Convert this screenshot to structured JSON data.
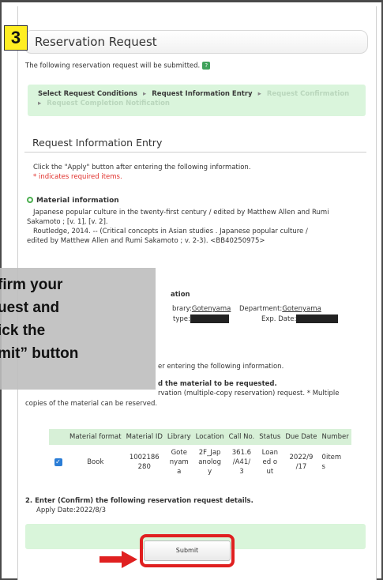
{
  "step_badge": "3",
  "title": "Reservation Request",
  "intro": "The following reservation request will be submitted.",
  "steps": {
    "s1": "Select Request Conditions",
    "s2": "Request Information Entry",
    "s3": "Request Confirmation",
    "s4": "Request Completion Notification",
    "separator": "▸"
  },
  "section_title": "Request Information Entry",
  "instructions": {
    "line1": "Click the \"Apply\" button after entering the following information.",
    "line2": "* indicates required items."
  },
  "material": {
    "heading": "Material information",
    "line1": "Japanese popular culture in the twenty-first century / edited by Matthew Allen and Rumi",
    "line2": "Sakamoto ; [v. 1], [v. 2].",
    "line3": "Routledge, 2014. -- (Critical concepts in Asian studies . Japanese popular culture /",
    "line4": "edited by Matthew Allen and Rumi Sakamoto ; v. 2-3).  <BB40250975>"
  },
  "user_info": {
    "heading_partial": "ation",
    "library_label": "brary:",
    "library_value": "Gotenyama",
    "type_label": "type:",
    "department_label": "Department:",
    "department_value": "Gotenyama",
    "exp_label": "Exp. Date:"
  },
  "instructions2": "er entering the following information.",
  "step1_partial": "d the material to be requested.",
  "reservation_note1": "rvation (multiple-copy reservation) request. * Multiple",
  "reservation_note2": "copies of the material can be reserved.",
  "table": {
    "headers": [
      "Material format",
      "Material ID",
      "Library",
      "Location",
      "Call No.",
      "Status",
      "Due Date",
      "Number"
    ],
    "row": {
      "format": "Book",
      "id_1": "1002186",
      "id_2": "280",
      "lib_1": "Gote",
      "lib_2": "nyam",
      "lib_3": "a",
      "loc_1": "2F_Jap",
      "loc_2": "anolog",
      "loc_3": "y",
      "call_1": "361.6",
      "call_2": "/A41/",
      "call_3": "3",
      "status_1": "Loan",
      "status_2": "ed o",
      "status_3": "ut",
      "due_1": "2022/9",
      "due_2": "/17",
      "num_1": "0item",
      "num_2": "s"
    }
  },
  "step2": {
    "heading": "2. Enter (Confirm) the following reservation request details.",
    "apply_date_label": "Apply Date:",
    "apply_date": "2022/8/3"
  },
  "submit_label": "Submit",
  "callout": {
    "line1": "firm your",
    "line2": "uest and",
    "line3": "ick the",
    "line4": "mit” button"
  },
  "colors": {
    "accent_green": "#daf5dc",
    "highlight_red": "#e02020",
    "badge_yellow": "#ffee22"
  }
}
